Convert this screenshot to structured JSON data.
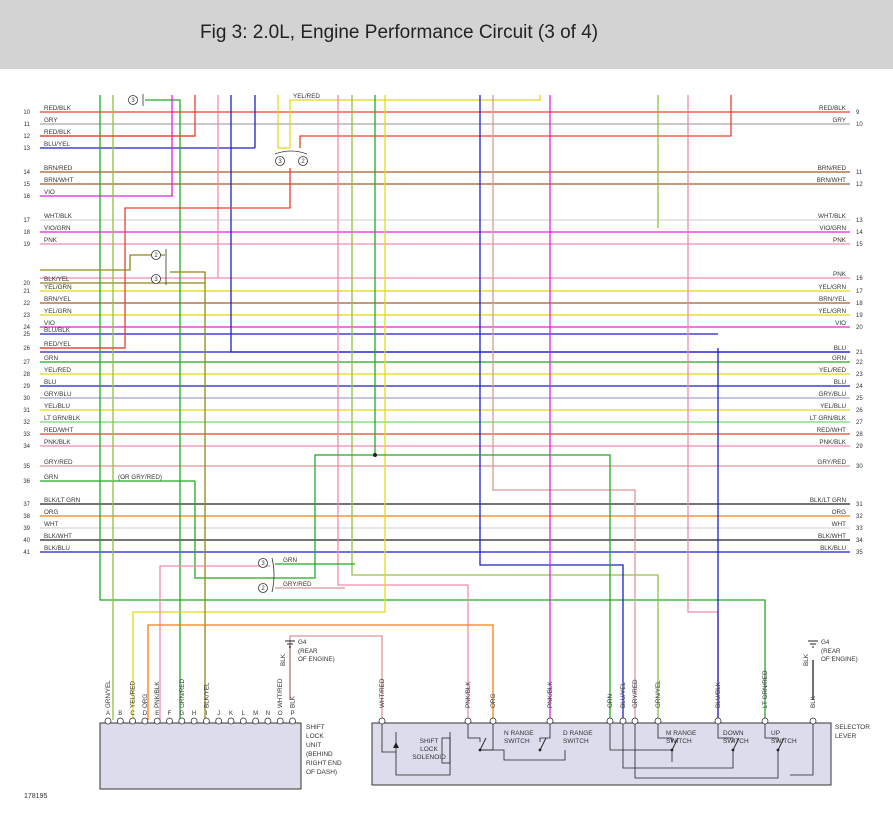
{
  "title": "Fig 3: 2.0L, Engine Performance Circuit (3 of 4)",
  "figure_id": "178195",
  "colors": {
    "RED": "#e8402c",
    "GRY": "#a8a8a8",
    "BLU": "#1f1fc8",
    "BRN": "#a05a28",
    "VIO": "#e020e0",
    "WHT": "#d8d8d8",
    "PNK": "#f08ab0",
    "YEL": "#e8d818",
    "GRN": "#22aa22",
    "ORG": "#f08010",
    "LTGRN": "#70d870",
    "BLK": "#222222",
    "GRY_RED": "#d89898",
    "GRY_BLU": "#a0a0d8",
    "GRN_YEL": "#90c040",
    "BLK_YEL": "#908818",
    "BLU_YEL": "#5050c8"
  },
  "rows": [
    {
      "left_num": "10",
      "left_label": "RED/BLK",
      "right_label": "RED/BLK",
      "right_num": "9",
      "color": "RED"
    },
    {
      "left_num": "11",
      "left_label": "GRY",
      "right_label": "GRY",
      "right_num": "10",
      "color": "GRY"
    },
    {
      "left_num": "12",
      "left_label": "RED/BLK",
      "right_label": "",
      "right_num": "",
      "color": "RED"
    },
    {
      "left_num": "13",
      "left_label": "BLU/YEL",
      "right_label": "",
      "right_num": "",
      "color": "BLU"
    },
    {
      "left_num": "14",
      "left_label": "BRN/RED",
      "right_label": "BRN/RED",
      "right_num": "11",
      "color": "BRN"
    },
    {
      "left_num": "15",
      "left_label": "BRN/WHT",
      "right_label": "BRN/WHT",
      "right_num": "12",
      "color": "BRN"
    },
    {
      "left_num": "16",
      "left_label": "VIO",
      "right_label": "",
      "right_num": "",
      "color": "VIO"
    },
    {
      "left_num": "17",
      "left_label": "WHT/BLK",
      "right_label": "WHT/BLK",
      "right_num": "13",
      "color": "WHT"
    },
    {
      "left_num": "18",
      "left_label": "VIO/GRN",
      "right_label": "VIO/GRN",
      "right_num": "14",
      "color": "VIO"
    },
    {
      "left_num": "19",
      "left_label": "PNK",
      "right_label": "PNK",
      "right_num": "15",
      "color": "PNK"
    },
    {
      "left_num": "",
      "left_label": "",
      "right_label": "PNK",
      "right_num": "16",
      "color": "PNK"
    },
    {
      "left_num": "20",
      "left_label": "BLK/YEL",
      "right_label": "",
      "right_num": "",
      "color": "BLK_YEL"
    },
    {
      "left_num": "21",
      "left_label": "YEL/GRN",
      "right_label": "YEL/GRN",
      "right_num": "17",
      "color": "YEL"
    },
    {
      "left_num": "22",
      "left_label": "BRN/YEL",
      "right_label": "BRN/YEL",
      "right_num": "18",
      "color": "BRN"
    },
    {
      "left_num": "23",
      "left_label": "YEL/GRN",
      "right_label": "YEL/GRN",
      "right_num": "19",
      "color": "YEL"
    },
    {
      "left_num": "24",
      "left_label": "VIO",
      "right_label": "VIO",
      "right_num": "20",
      "color": "VIO"
    },
    {
      "left_num": "25",
      "left_label": "BLU/BLK",
      "right_label": "",
      "right_num": "",
      "color": "BLU"
    },
    {
      "left_num": "26",
      "left_label": "RED/YEL",
      "right_label": "",
      "right_num": "",
      "color": "RED"
    },
    {
      "left_num": "",
      "left_label": "",
      "right_label": "BLU",
      "right_num": "21",
      "color": "BLU"
    },
    {
      "left_num": "27",
      "left_label": "GRN",
      "right_label": "GRN",
      "right_num": "22",
      "color": "GRN"
    },
    {
      "left_num": "28",
      "left_label": "YEL/RED",
      "right_label": "YEL/RED",
      "right_num": "23",
      "color": "YEL"
    },
    {
      "left_num": "29",
      "left_label": "BLU",
      "right_label": "BLU",
      "right_num": "24",
      "color": "BLU"
    },
    {
      "left_num": "30",
      "left_label": "GRY/BLU",
      "right_label": "GRY/BLU",
      "right_num": "25",
      "color": "GRY_BLU"
    },
    {
      "left_num": "31",
      "left_label": "YEL/BLU",
      "right_label": "YEL/BLU",
      "right_num": "26",
      "color": "YEL"
    },
    {
      "left_num": "32",
      "left_label": "LT GRN/BLK",
      "right_label": "LT GRN/BLK",
      "right_num": "27",
      "color": "LTGRN"
    },
    {
      "left_num": "33",
      "left_label": "RED/WHT",
      "right_label": "RED/WHT",
      "right_num": "28",
      "color": "RED"
    },
    {
      "left_num": "34",
      "left_label": "PNK/BLK",
      "right_label": "PNK/BLK",
      "right_num": "29",
      "color": "PNK"
    },
    {
      "left_num": "35",
      "left_label": "GRY/RED",
      "right_label": "GRY/RED",
      "right_num": "30",
      "color": "GRY_RED"
    },
    {
      "left_num": "36",
      "left_label": "GRN",
      "right_label": "",
      "right_num": "",
      "color": "GRN",
      "note": "(OR GRY/RED)"
    },
    {
      "left_num": "37",
      "left_label": "BLK/LT GRN",
      "right_label": "BLK/LT GRN",
      "right_num": "31",
      "color": "BLK"
    },
    {
      "left_num": "38",
      "left_label": "ORG",
      "right_label": "ORG",
      "right_num": "32",
      "color": "ORG"
    },
    {
      "left_num": "39",
      "left_label": "WHT",
      "right_label": "WHT",
      "right_num": "33",
      "color": "WHT"
    },
    {
      "left_num": "40",
      "left_label": "BLK/WHT",
      "right_label": "BLK/WHT",
      "right_num": "34",
      "color": "BLK"
    },
    {
      "left_num": "41",
      "left_label": "BLK/BLU",
      "right_label": "BLK/BLU",
      "right_num": "35",
      "color": "BLU"
    }
  ],
  "top_labels": {
    "yel_red": "YEL/RED"
  },
  "splices": [
    {
      "a": "3",
      "b": "",
      "wires": []
    },
    {
      "a": "3",
      "b": "2",
      "wires": []
    },
    {
      "a": "2",
      "b": "3",
      "wires": []
    },
    {
      "a": "3",
      "b": "2",
      "wires": [
        "GRN",
        "GRY/RED"
      ]
    }
  ],
  "grounds": [
    {
      "name": "G4",
      "location": "(REAR\nOF ENGINE)",
      "wire": "BLK"
    },
    {
      "name": "G4",
      "location": "(REAR\nOF ENGINE)",
      "wire": "BLK"
    }
  ],
  "shift_lock_unit": {
    "pin_letters": [
      "A",
      "B",
      "C",
      "D",
      "E",
      "F",
      "G",
      "H",
      "I",
      "J",
      "K",
      "L",
      "M",
      "N",
      "O",
      "P"
    ],
    "pin_wires": [
      "GRN/YEL",
      "",
      "YEL/RED",
      "ORG",
      "PNK/BLK",
      "",
      "GRN/RED",
      "",
      "BLK/YEL",
      "",
      "",
      "",
      "",
      "",
      "WHT/RED",
      "BLK"
    ],
    "label": "SHIFT\nLOCK\nUNIT\n(BEHIND\nRIGHT END\nOF DASH)"
  },
  "selector_lever": {
    "label": "SELECTOR\nLEVER",
    "pin_wires": [
      "WHT/RED",
      "PNK/BLK",
      "ORG",
      "PNK/BLK",
      "GRN",
      "BLU/YEL",
      "GRY/RED",
      "GRN/YEL",
      "BLU/BLK",
      "LT GRN/RED",
      "BLK"
    ],
    "components": [
      {
        "name": "SHIFT\nLOCK\nSOLENOID"
      },
      {
        "name": "N RANGE\nSWITCH"
      },
      {
        "name": "D RANGE\nSWITCH"
      },
      {
        "name": "M RANGE\nSWITCH"
      },
      {
        "name": "DOWN\nSWITCH"
      },
      {
        "name": "UP\nSWITCH"
      }
    ]
  }
}
